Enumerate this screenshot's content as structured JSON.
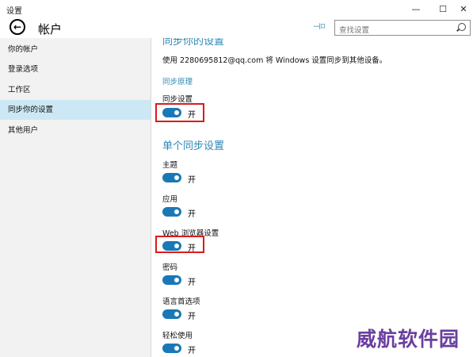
{
  "window": {
    "title": "设置"
  },
  "header": {
    "title": "帐户",
    "search_placeholder": "查找设置"
  },
  "sidebar": {
    "items": [
      {
        "label": "你的帐户"
      },
      {
        "label": "登录选项"
      },
      {
        "label": "工作区"
      },
      {
        "label": "同步你的设置",
        "selected": true
      },
      {
        "label": "其他用户"
      }
    ]
  },
  "content": {
    "section1_title": "同步你的设置",
    "description": "使用 2280695812@qq.com 将 Windows 设置同步到其他设备。",
    "link": "同步原理",
    "section2_title": "单个同步设置",
    "settings": [
      {
        "label": "同步设置",
        "state": "开"
      },
      {
        "label": "主题",
        "state": "开"
      },
      {
        "label": "应用",
        "state": "开"
      },
      {
        "label": "Web 浏览器设置",
        "state": "开"
      },
      {
        "label": "密码",
        "state": "开"
      },
      {
        "label": "语言首选项",
        "state": "开"
      },
      {
        "label": "轻松使用",
        "state": "开"
      }
    ]
  },
  "watermark": "威航软件园",
  "colors": {
    "accent": "#2b88b6",
    "toggle_on": "#1a78b6",
    "highlight": "#d81c1c",
    "watermark": "#6b3fa0"
  },
  "icons": {
    "back": "back-arrow-icon",
    "pin": "pin-icon",
    "search": "search-icon"
  }
}
